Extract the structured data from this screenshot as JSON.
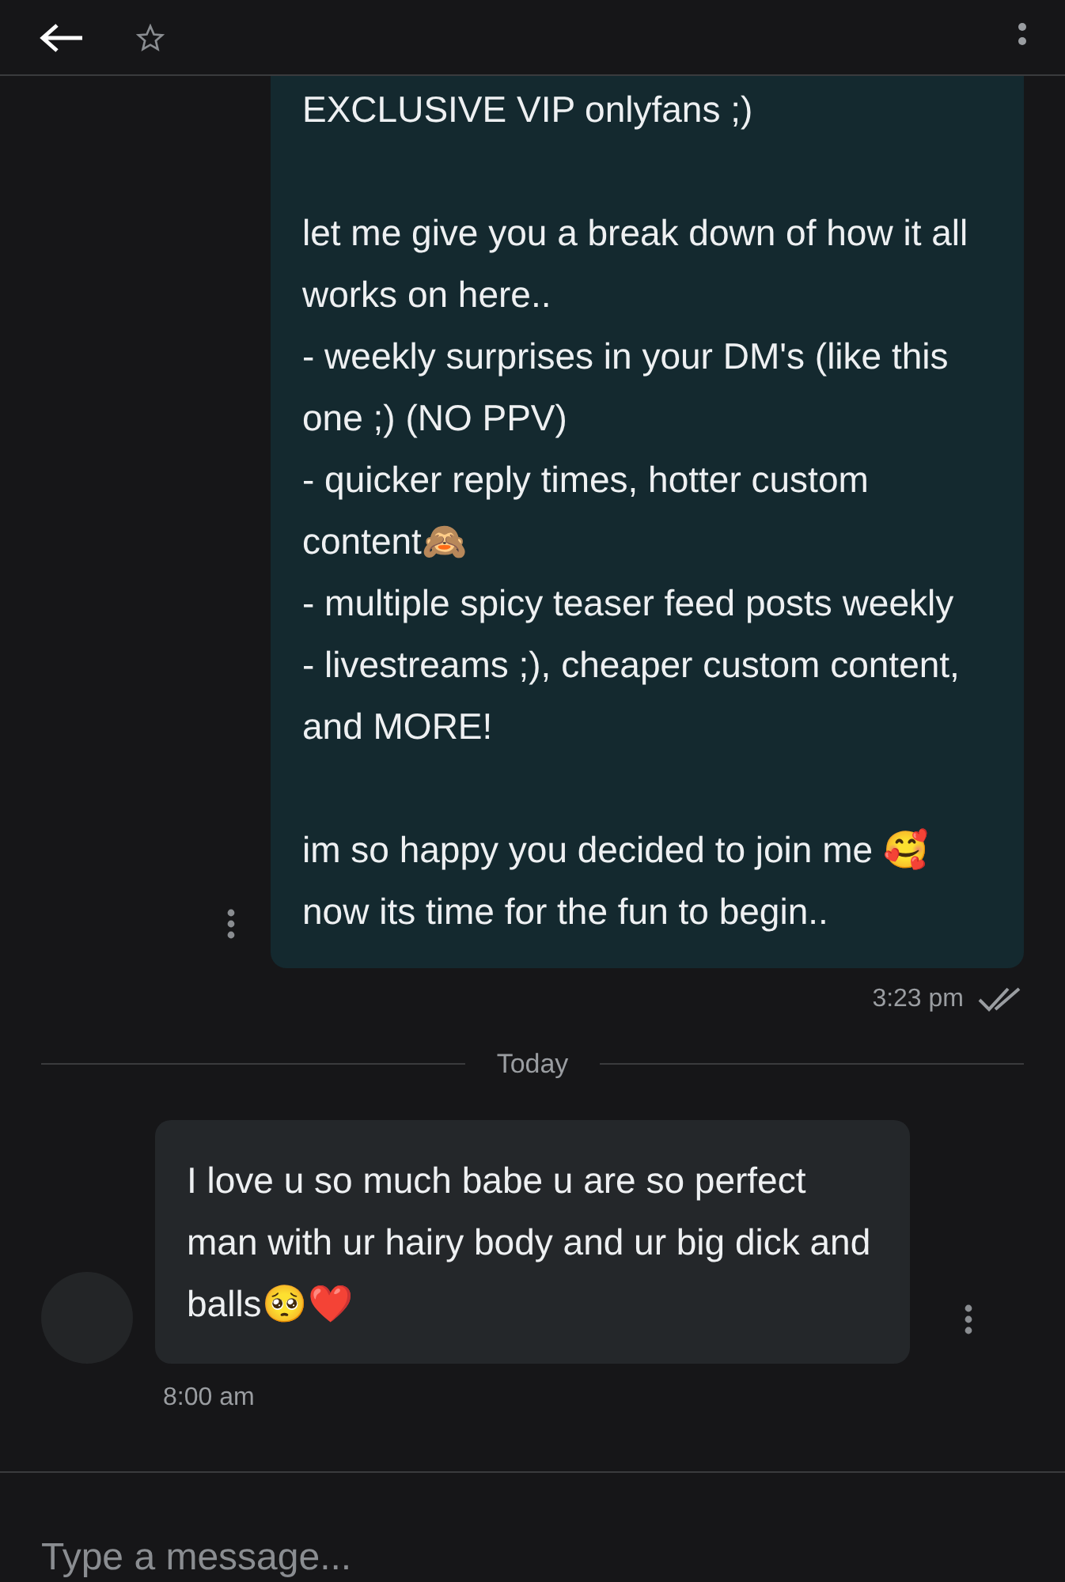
{
  "messages": [
    {
      "kind": "outgoing",
      "text": "EXCLUSIVE VIP onlyfans ;)\n\nlet me give you a break down of how it all works on here..\n- weekly surprises in your DM's (like this one ;) (NO PPV)\n- quicker reply times, hotter custom content🙈\n- multiple spicy teaser feed posts weekly\n- livestreams ;), cheaper custom content, and MORE!\n\nim so happy you decided to join me 🥰 now its time for the fun to begin..",
      "time": "3:23 pm",
      "read": true
    },
    {
      "kind": "divider",
      "text": "Today"
    },
    {
      "kind": "incoming",
      "text": "I love u so much babe u are so perfect man with ur hairy body and ur big dick and balls🥺❤️",
      "time": "8:00 am"
    }
  ],
  "composer": {
    "placeholder": "Type a message..."
  }
}
